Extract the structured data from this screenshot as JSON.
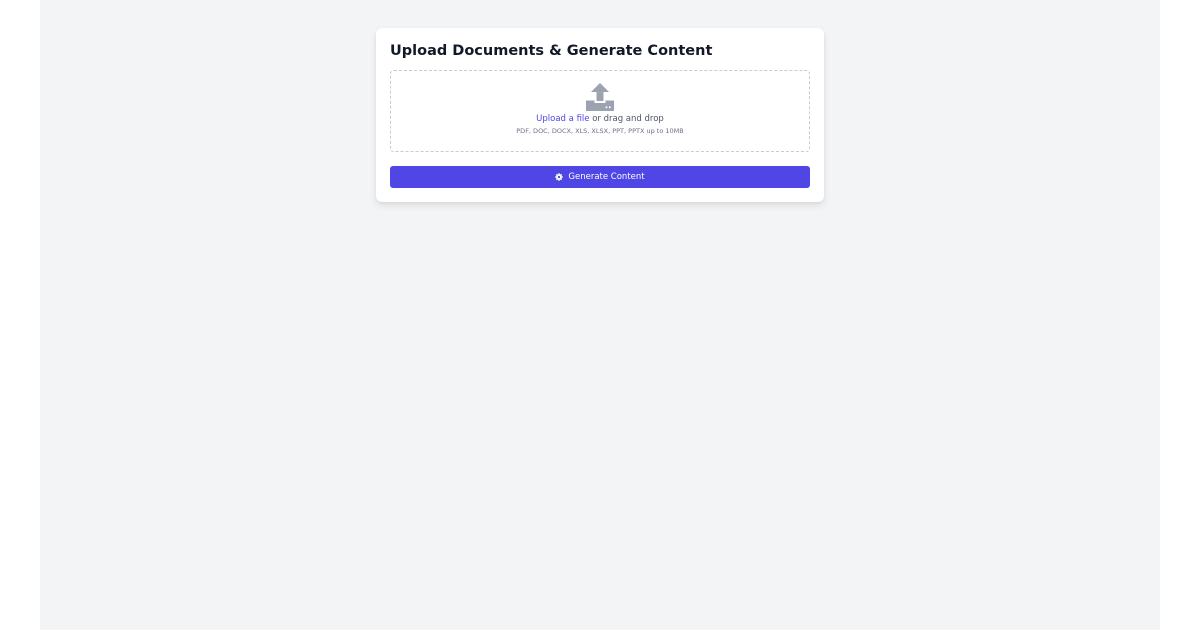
{
  "colors": {
    "page_background": "#f3f4f6",
    "card_background": "#ffffff",
    "accent": "#4f46e5",
    "title_text": "#111827",
    "muted_text": "#6b7280",
    "icon_gray": "#9ca3af"
  },
  "card": {
    "title": "Upload Documents & Generate Content"
  },
  "dropzone": {
    "icon": "upload-icon",
    "upload_link": "Upload a file",
    "drag_text": " or drag and drop",
    "formats": "PDF, DOC, DOCX, XLS, XLSX, PPT, PPTX up to 10MB"
  },
  "actions": {
    "generate_icon": "gear-icon",
    "generate_label": "Generate Content"
  }
}
